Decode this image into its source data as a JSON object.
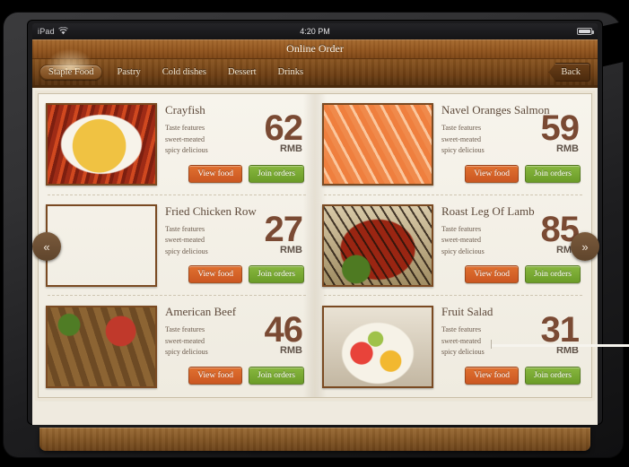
{
  "status_bar": {
    "device": "iPad",
    "wifi_icon": "wifi-icon",
    "time": "4:20 PM",
    "battery_icon": "battery-icon"
  },
  "header": {
    "title": "Online Order"
  },
  "tabs": [
    {
      "label": "Staple Food",
      "active": true
    },
    {
      "label": "Pastry",
      "active": false
    },
    {
      "label": "Cold dishes",
      "active": false
    },
    {
      "label": "Dessert",
      "active": false
    },
    {
      "label": "Drinks",
      "active": false
    }
  ],
  "back_button": {
    "label": "Back"
  },
  "pager": {
    "prev_label": "«",
    "next_label": "»"
  },
  "buttons": {
    "view_label": "View food",
    "join_label": "Join orders"
  },
  "colors": {
    "view_button": "#d9622b",
    "join_button": "#72a832",
    "price_text": "#7a4a33",
    "wood_header": "#93561f",
    "page_background": "#efeadf"
  },
  "items": [
    {
      "name": "Crayfish",
      "features": [
        "Taste features",
        "sweet-meated",
        "spicy delicious"
      ],
      "price": "62",
      "currency": "RMB",
      "image": "crayfish-photo"
    },
    {
      "name": "Navel Oranges Salmon",
      "features": [
        "Taste features",
        "sweet-meated",
        "spicy delicious"
      ],
      "price": "59",
      "currency": "RMB",
      "image": "salmon-photo"
    },
    {
      "name": "Fried Chicken Row",
      "features": [
        "Taste features",
        "sweet-meated",
        "spicy delicious"
      ],
      "price": "27",
      "currency": "RMB",
      "image": "fried-chicken-photo"
    },
    {
      "name": "Roast Leg Of Lamb",
      "features": [
        "Taste features",
        "sweet-meated",
        "spicy delicious"
      ],
      "price": "85",
      "currency": "RMB",
      "image": "roast-lamb-photo"
    },
    {
      "name": "American Beef",
      "features": [
        "Taste features",
        "sweet-meated",
        "spicy delicious"
      ],
      "price": "46",
      "currency": "RMB",
      "image": "american-beef-photo"
    },
    {
      "name": "Fruit Salad",
      "features": [
        "Taste features",
        "sweet-meated",
        "spicy delicious"
      ],
      "price": "31",
      "currency": "RMB",
      "image": "fruit-salad-photo"
    }
  ]
}
